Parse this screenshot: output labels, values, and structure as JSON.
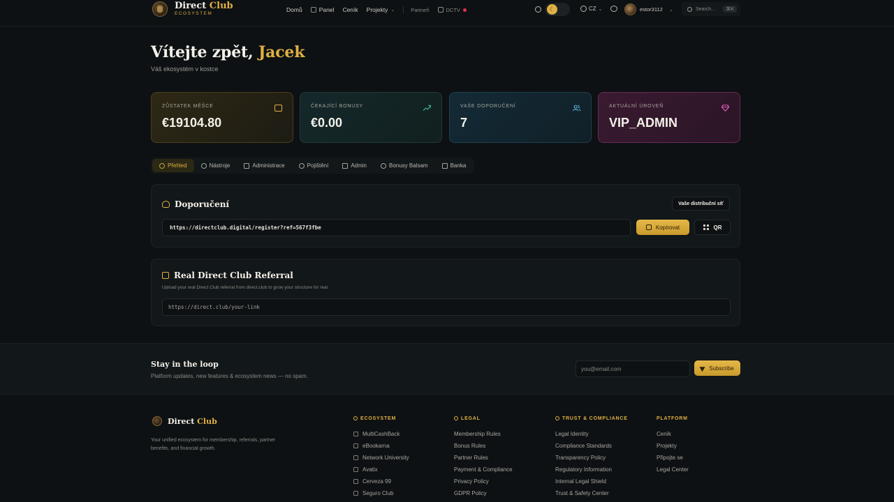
{
  "header": {
    "logo_main_1": "Direct",
    "logo_main_2": "Club",
    "logo_sub": "ECOSYSTEM",
    "nav": [
      "Domů",
      "Panel",
      "Ceník",
      "Projekty"
    ],
    "nav_secondary": [
      "Partneři",
      "DCTV"
    ],
    "language": "CZ",
    "username": "estor3112",
    "search_placeholder": "Search...",
    "search_shortcut": "⌘K"
  },
  "welcome": {
    "greeting": "Vítejte zpět,",
    "name": "Jacek",
    "subtitle": "Váš ekosystém v kostce"
  },
  "stats": [
    {
      "label": "ZŮSTATEK MĚŠCE",
      "value": "€19104.80",
      "icon": "wallet-icon"
    },
    {
      "label": "ČEKAJÍCÍ BONUSY",
      "value": "€0.00",
      "icon": "trend-up-icon"
    },
    {
      "label": "VAŠE DOPORUČENÍ",
      "value": "7",
      "icon": "users-icon"
    },
    {
      "label": "AKTUÁLNÍ ÚROVEŇ",
      "value": "VIP_ADMIN",
      "icon": "diamond-icon"
    }
  ],
  "tabs": [
    "Přehled",
    "Nástroje",
    "Administrace",
    "Pojištění",
    "Admin",
    "Bonusy Balsam",
    "Banka"
  ],
  "referral": {
    "title": "Doporučení",
    "network_button": "Vaše distribuční síť",
    "link": "https://directclub.digital/register?ref=567f3fbe",
    "copy_button": "Kopírovat",
    "qr_button": "QR"
  },
  "real_referral": {
    "title": "Real Direct Club Referral",
    "description": "Upload your real Direct Club referral from direct.club to grow your structure for real.",
    "placeholder": "https://direct.club/your-link"
  },
  "newsletter": {
    "title": "Stay in the loop",
    "description": "Platform updates, new features & ecosystem news — no spam.",
    "placeholder": "you@email.com",
    "button": "Subscribe"
  },
  "footer": {
    "brand_1": "Direct",
    "brand_2": "Club",
    "description": "Your unified ecosystem for membership, referrals, partner benefits, and financial growth.",
    "columns": [
      {
        "title": "ECOSYSTEM",
        "items": [
          "MultiCashBack",
          "eBookarna",
          "Network University",
          "Avatix",
          "Cerveza 99",
          "Seguro Club"
        ]
      },
      {
        "title": "LEGAL",
        "items": [
          "Membership Rules",
          "Bonus Rules",
          "Partner Rules",
          "Payment & Compliance",
          "Privacy Policy",
          "GDPR Policy"
        ]
      },
      {
        "title": "TRUST & COMPLIANCE",
        "items": [
          "Legal Identity",
          "Compliance Standards",
          "Transparency Policy",
          "Regulatory Information",
          "Internal Legal Shield",
          "Trust & Safety Center"
        ]
      },
      {
        "title": "PLATFORM",
        "items": [
          "Ceník",
          "Projekty",
          "Připojte se",
          "Legal Center"
        ]
      }
    ]
  },
  "colors": {
    "accent": "#e0b043",
    "background": "#0d1113",
    "panel": "#121719",
    "live": "#e0334a"
  }
}
